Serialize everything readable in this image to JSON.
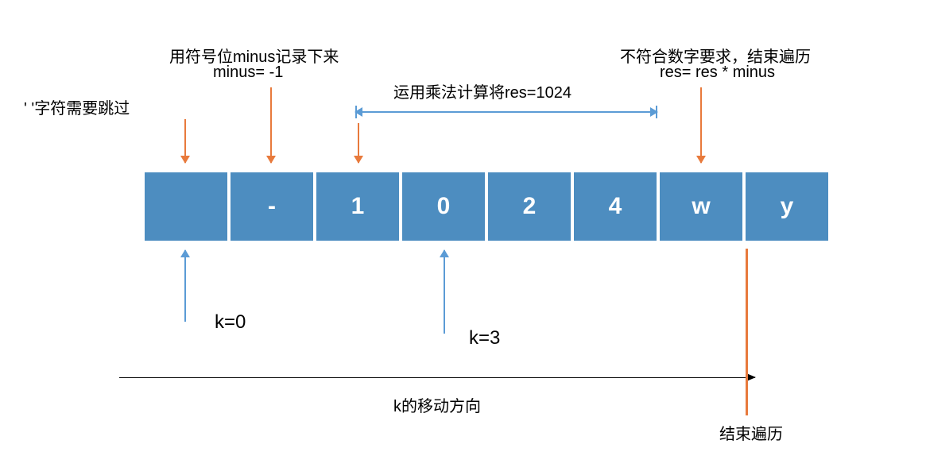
{
  "cells": [
    "",
    "-",
    "1",
    "0",
    "2",
    "4",
    "w",
    "y"
  ],
  "annotations": {
    "skip_char": "' '字符需要跳过",
    "minus_label_line1": "用符号位minus记录下来",
    "minus_label_line2": "minus= -1",
    "calc_label": "运用乘法计算将res=1024",
    "fail_label_line1": "不符合数字要求，结束遍历",
    "fail_label_line2": "res= res * minus",
    "k0": "k=0",
    "k3": "k=3",
    "k_dir": "k的移动方向",
    "end_label": "结束遍历"
  }
}
